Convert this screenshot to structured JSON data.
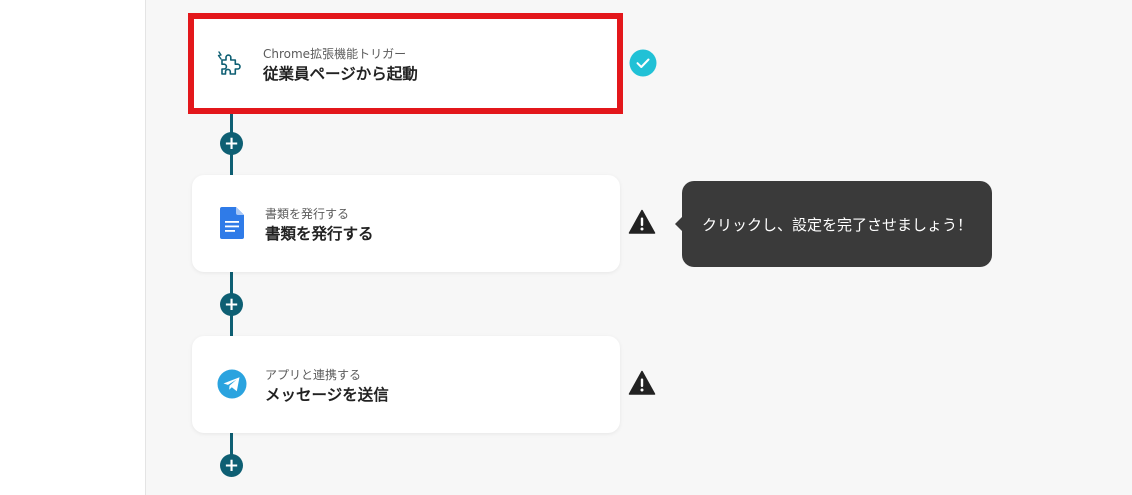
{
  "flow": {
    "steps": [
      {
        "subtitle": "Chrome拡張機能トリガー",
        "title": "従業員ページから起動",
        "icon": "puzzle-piece-icon",
        "status": "complete",
        "selected": true
      },
      {
        "subtitle": "書類を発行する",
        "title": "書類を発行する",
        "icon": "google-docs-icon",
        "status": "warning",
        "selected": false
      },
      {
        "subtitle": "アプリと連携する",
        "title": "メッセージを送信",
        "icon": "telegram-icon",
        "status": "warning",
        "selected": false
      }
    ],
    "add_step_symbol": "+"
  },
  "tooltip": {
    "text": "クリックし、設定を完了させましょう！"
  },
  "colors": {
    "connector": "#0e5f73",
    "highlight_border": "#e3171b",
    "complete": "#21c1d6",
    "warning": "#222222",
    "tooltip_bg": "#3a3a3a",
    "docs_blue": "#2f7be8",
    "telegram_blue": "#2aa3df"
  }
}
